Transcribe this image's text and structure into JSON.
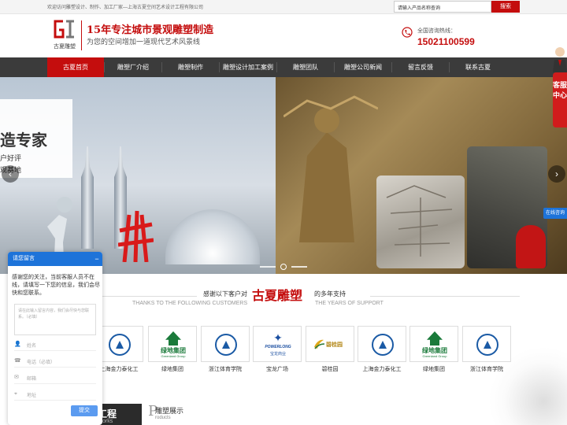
{
  "topbar": {
    "welcome": "欢迎访问雕塑设计、制作、加工厂家—上海古夏空间艺术设计工程有限公司",
    "search_placeholder": "请输入产品名称查询",
    "search_button": "搜索"
  },
  "header": {
    "logo_text": "古夏雕塑",
    "slogan_main": "15年专注城市景观雕塑制造",
    "slogan_sub": "为您的空间增加一道现代艺术风景线",
    "hotline_label": "全国咨询热线：",
    "hotline_number": "15021100599"
  },
  "nav": {
    "items": [
      {
        "label": "古夏首页"
      },
      {
        "label": "雕塑厂介绍"
      },
      {
        "label": "雕塑制作"
      },
      {
        "label": "雕塑设计加工案例"
      },
      {
        "label": "雕塑团队"
      },
      {
        "label": "雕塑公司新闻"
      },
      {
        "label": "留言反馈"
      },
      {
        "label": "联系古夏"
      }
    ],
    "active_index": 0
  },
  "banner": {
    "card_title": "造专家",
    "line1": "户好评",
    "line2": "观基地",
    "prev_symbol": "‹",
    "next_symbol": "›"
  },
  "side": {
    "service_label": "客服中心",
    "online_label": "在线咨询"
  },
  "clients_section": {
    "title_prefix": "感谢以下客户对",
    "title_brand": "古夏雕塑",
    "title_suffix": "的多年支持",
    "en_left": "THANKS TO THE FOLLOWING CUSTOMERS",
    "en_right": "THE YEARS OF SUPPORT",
    "clients": [
      {
        "name": "上海金力泰化工",
        "logo": "emblem"
      },
      {
        "name": "绿地集团",
        "logo": "greenland"
      },
      {
        "name": "浙江体育学院",
        "logo": "emblem"
      },
      {
        "name": "宝龙广场",
        "logo": "powerlong"
      },
      {
        "name": "碧桂园",
        "logo": "bgy"
      },
      {
        "name": "上海金力泰化工",
        "logo": "emblem"
      },
      {
        "name": "绿地集团",
        "logo": "greenland"
      },
      {
        "name": "浙江体育学院",
        "logo": "emblem"
      }
    ],
    "greenland_cn": "绿地集团",
    "greenland_en": "Greenland Group",
    "powerlong_en": "POWERLONG",
    "powerlong_cn": "宝龙商业",
    "bgy_text": "碧桂园"
  },
  "bottom": {
    "left_title": "塑工程",
    "left_en": "culture works",
    "right_letter": "P",
    "right_title": "雕塑展示",
    "right_en": "roducts"
  },
  "chat": {
    "title": "请您留言",
    "minimize": "−",
    "message": "感谢您的关注，当前客服人员不在线，请填写一下您的信息，我们会尽快和您联系。",
    "textarea_placeholder": "请在此输入留言内容，我们会尽快与您联系。（必填）",
    "fields": [
      {
        "icon": "user-icon",
        "glyph": "👤",
        "placeholder": "姓名"
      },
      {
        "icon": "phone-icon",
        "glyph": "☎",
        "placeholder": "电话（必填）"
      },
      {
        "icon": "mail-icon",
        "glyph": "✉",
        "placeholder": "邮箱"
      },
      {
        "icon": "location-icon",
        "glyph": "⌖",
        "placeholder": "地址"
      }
    ],
    "send_button": "提交"
  },
  "colors": {
    "brand_red": "#c40d0d",
    "nav_bg": "#3b3b3b",
    "chat_blue": "#1d73d9"
  }
}
